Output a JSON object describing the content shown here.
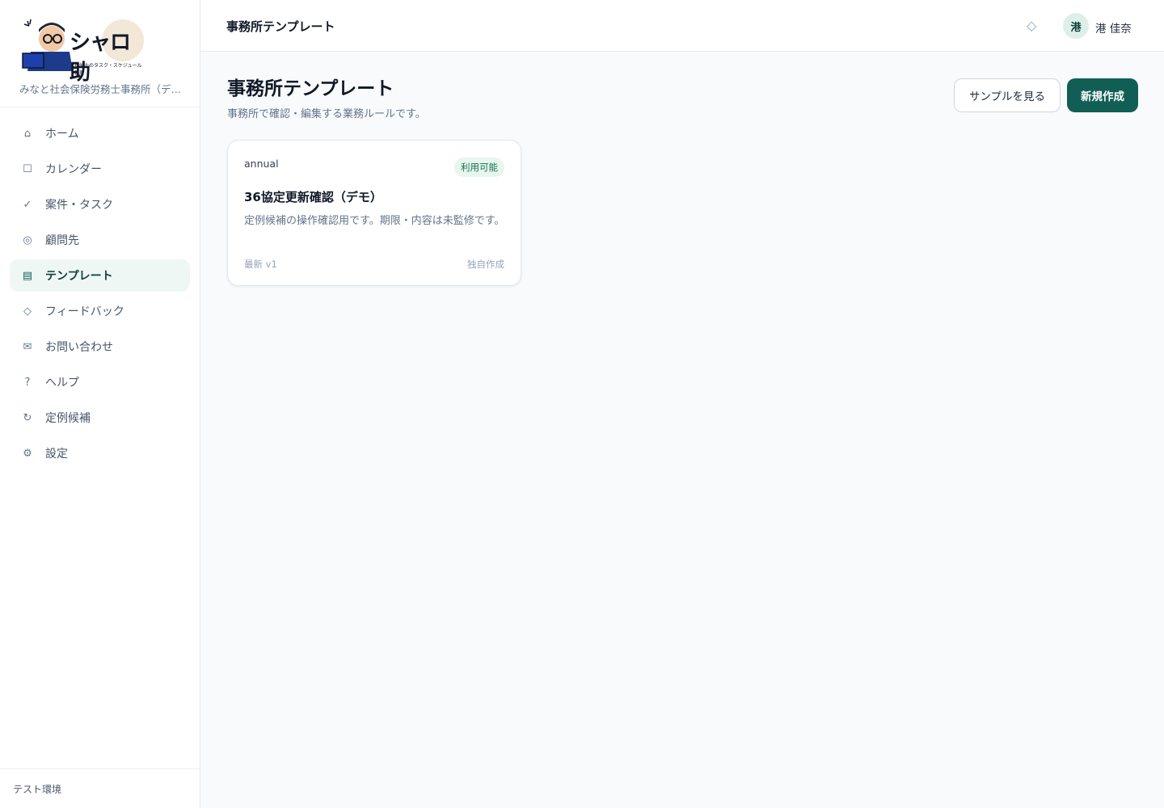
{
  "sidebar": {
    "logo_text": "シャロ助",
    "logo_sub": "社労士のタスク・スケジュール管理",
    "office_name": "みなと社会保険労務士事務所（デ…",
    "items": [
      {
        "label": "ホーム",
        "icon": "home-icon",
        "glyph": "⌂"
      },
      {
        "label": "カレンダー",
        "icon": "calendar-icon",
        "glyph": "☐"
      },
      {
        "label": "案件・タスク",
        "icon": "check-icon",
        "glyph": "✓"
      },
      {
        "label": "顧問先",
        "icon": "client-icon",
        "glyph": "◎"
      },
      {
        "label": "テンプレート",
        "icon": "template-icon",
        "glyph": "▤"
      },
      {
        "label": "フィードバック",
        "icon": "diamond-icon",
        "glyph": "◇"
      },
      {
        "label": "お問い合わせ",
        "icon": "mail-icon",
        "glyph": "✉"
      },
      {
        "label": "ヘルプ",
        "icon": "help-icon",
        "glyph": "?"
      },
      {
        "label": "定例候補",
        "icon": "refresh-icon",
        "glyph": "↻"
      },
      {
        "label": "設定",
        "icon": "settings-icon",
        "glyph": "⚙"
      }
    ],
    "active_index": 4,
    "footer": "テスト環境"
  },
  "header": {
    "title": "事務所テンプレート",
    "feedback_glyph": "◇",
    "avatar_initial": "港",
    "user_name": "港 佳奈"
  },
  "main": {
    "title": "事務所テンプレート",
    "subtitle": "事務所で確認・編集する業務ルールです。",
    "sample_button": "サンプルを見る",
    "new_button": "新規作成",
    "cards": [
      {
        "category": "annual",
        "status": "利用可能",
        "title": "36協定更新確認（デモ）",
        "description": "定例候補の操作確認用です。期限・内容は未監修です。",
        "version": "最新 v1",
        "origin": "独自作成"
      }
    ]
  },
  "colors": {
    "accent": "#115e54",
    "active_bg": "#eef7f4",
    "badge_bg": "#e8f6ef",
    "badge_text": "#137353"
  }
}
